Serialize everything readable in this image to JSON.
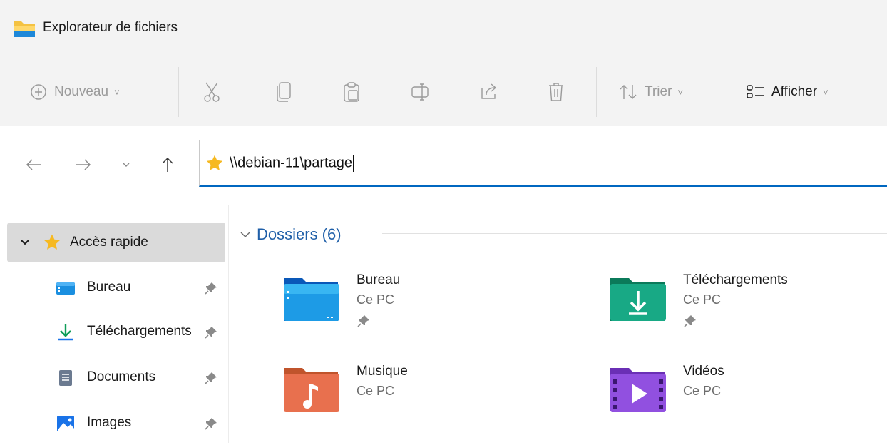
{
  "window": {
    "title": "Explorateur de fichiers"
  },
  "toolbar": {
    "new_label": "Nouveau",
    "sort_label": "Trier",
    "view_label": "Afficher",
    "icons": [
      "add-circle-icon",
      "cut-icon",
      "copy-icon",
      "paste-icon",
      "rename-icon",
      "share-icon",
      "delete-icon",
      "sort-icon",
      "view-icon"
    ]
  },
  "address": {
    "path": "\\\\debian-11\\partage"
  },
  "sidebar": {
    "quick_access": "Accès rapide",
    "items": [
      {
        "label": "Bureau",
        "icon": "desktop-icon"
      },
      {
        "label": "Téléchargements",
        "icon": "download-icon"
      },
      {
        "label": "Documents",
        "icon": "document-icon"
      },
      {
        "label": "Images",
        "icon": "images-icon"
      }
    ]
  },
  "content": {
    "group_title": "Dossiers (6)",
    "folders": [
      {
        "name": "Bureau",
        "location": "Ce PC",
        "pinned": true,
        "icon": "desktop-folder-icon"
      },
      {
        "name": "Téléchargements",
        "location": "Ce PC",
        "pinned": true,
        "icon": "downloads-folder-icon"
      },
      {
        "name": "Musique",
        "location": "Ce PC",
        "pinned": false,
        "icon": "music-folder-icon"
      },
      {
        "name": "Vidéos",
        "location": "Ce PC",
        "pinned": false,
        "icon": "videos-folder-icon"
      }
    ]
  },
  "colors": {
    "accent": "#0067c0",
    "group_title": "#1f5fa8",
    "selected_bg": "#dadada",
    "chrome_bg": "#f3f3f3"
  }
}
